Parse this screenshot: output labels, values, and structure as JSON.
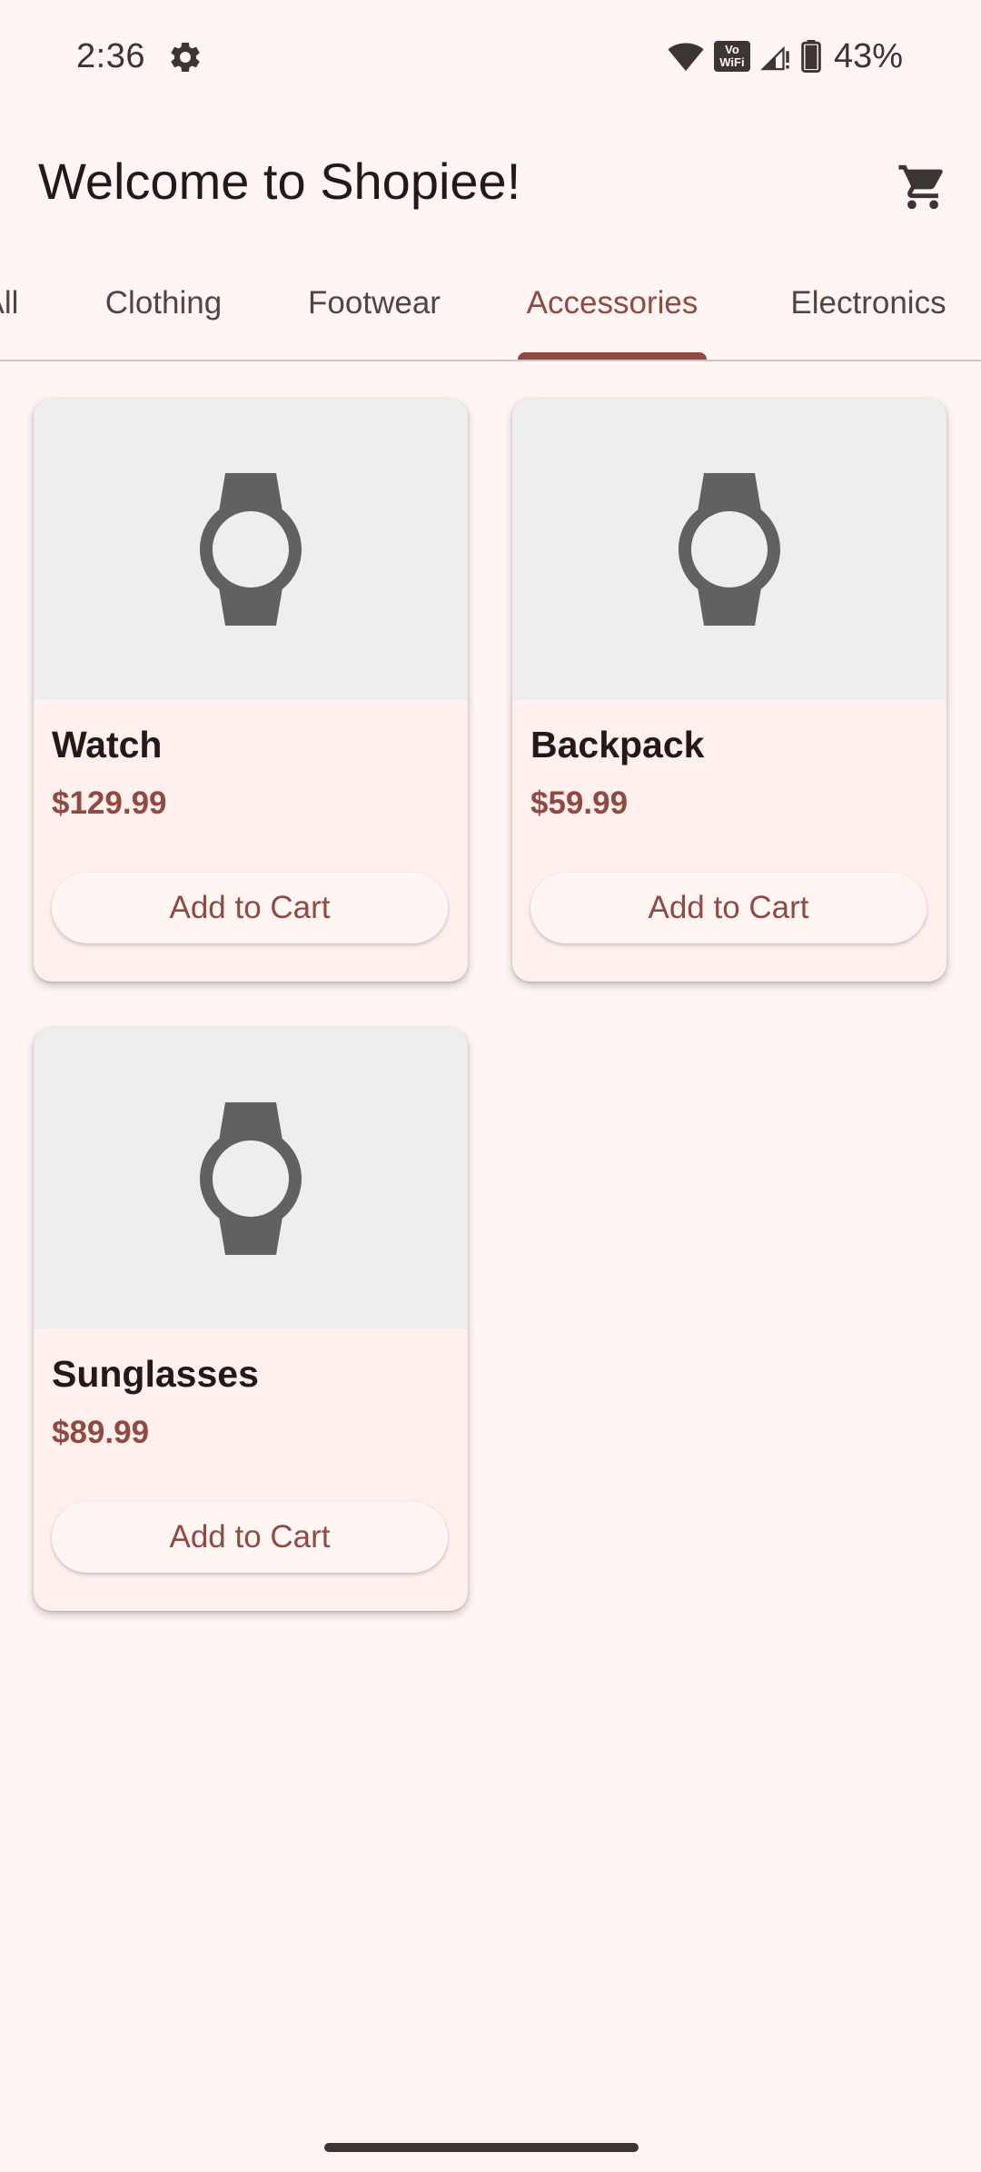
{
  "status_bar": {
    "time": "2:36",
    "settings_icon": "gear-icon",
    "wifi_icon": "wifi-icon",
    "vowifi_top": "Vo",
    "vowifi_bottom": "WiFi",
    "signal_icon": "signal-icon",
    "battery_icon": "battery-icon",
    "battery_percent": "43%"
  },
  "app_bar": {
    "title": "Welcome to Shopiee!",
    "cart_icon": "shopping-cart-icon"
  },
  "tabs": [
    {
      "label": "All",
      "active": false
    },
    {
      "label": "Clothing",
      "active": false
    },
    {
      "label": "Footwear",
      "active": false
    },
    {
      "label": "Accessories",
      "active": true
    },
    {
      "label": "Electronics",
      "active": false
    }
  ],
  "products": [
    {
      "name": "Watch",
      "price": "$129.99",
      "button_label": "Add to Cart",
      "icon": "watch-icon"
    },
    {
      "name": "Backpack",
      "price": "$59.99",
      "button_label": "Add to Cart",
      "icon": "watch-icon"
    },
    {
      "name": "Sunglasses",
      "price": "$89.99",
      "button_label": "Add to Cart",
      "icon": "watch-icon"
    }
  ],
  "colors": {
    "background": "#fff6f4",
    "accent": "#904a44",
    "card_background": "#fff0ee",
    "image_placeholder": "#eeeeee",
    "icon_gray": "#616161"
  }
}
